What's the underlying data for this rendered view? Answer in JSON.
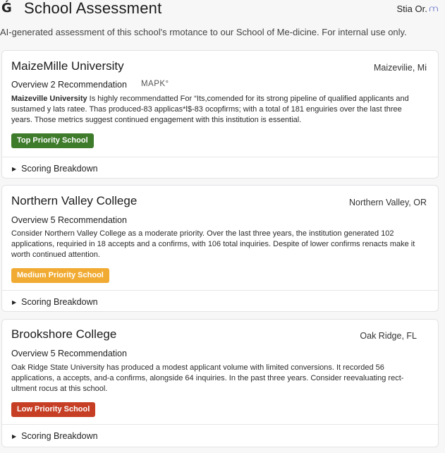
{
  "header": {
    "logo_glyph": "Ǵ",
    "title": "School Assessment",
    "user_name": "Stia Or.",
    "user_icon": "user-menu-icon"
  },
  "subtitle": "AI-generated assessment of this school's rmotance to our School of Me-dicine. For internal use only.",
  "cards": [
    {
      "title": "MaizeMille University",
      "location": "Maizevilie, Mi",
      "recommendation": "Overview 2 Recommendation",
      "rec_tag": "MAPK°",
      "desc_name": "Maizeville University",
      "desc_rest": " Is highly recommendatted For “Its,comended for its strong pipeline of qualified applicants and sustamed y lats ratee. Thas produced-83 applicas*l$-83 ocopfirms; with a total of 181 enguiries over the last three years. Those metrics suggest continued engagement with this institution is essential.",
      "badge": "Top Priority School",
      "badge_color": "#3e7b2b",
      "breakdown": "Scoring Breakdown"
    },
    {
      "title": "Northern Valley College",
      "location": "Northern Valley, OR",
      "recommendation": "Overview 5 Recommendation",
      "description": "Consider Northern Valley College as a moderate priority. Over the last three years, the institution generated 102 applications, requiried in 18 accepts and a confirms, with 106 total inquiries. Despite of lower confirms renacts make it worth continued attention.",
      "badge": "Medium Priority School",
      "badge_color": "#f1ab33",
      "breakdown": "Scoring Breakdown"
    },
    {
      "title": "Brookshore College",
      "location": "Oak Ridge, FL",
      "recommendation": "Overview 5 Recommendation",
      "description": "Oak Ridge State University has produced a modest applicant volume with limited conversions. It recorded 56 applications, a accepts, and-a confirms, alongside 64 inquiries. In the past three years. Consider reevaluating rect-ultment rocus at this school.",
      "badge": "Low Priority School",
      "badge_color": "#c63f24",
      "breakdown": "Scoring Breakdown"
    }
  ]
}
